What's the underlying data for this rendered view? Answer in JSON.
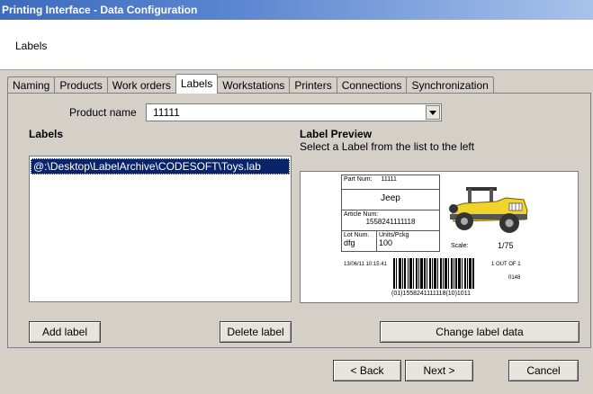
{
  "window": {
    "title": "Printing Interface - Data Configuration"
  },
  "header": {
    "step_title": "Labels"
  },
  "tabs": [
    {
      "label": "Naming",
      "active": false
    },
    {
      "label": "Products",
      "active": false
    },
    {
      "label": "Work orders",
      "active": false
    },
    {
      "label": "Labels",
      "active": true
    },
    {
      "label": "Workstations",
      "active": false
    },
    {
      "label": "Printers",
      "active": false
    },
    {
      "label": "Connections",
      "active": false
    },
    {
      "label": "Synchronization",
      "active": false
    }
  ],
  "product": {
    "label": "Product name",
    "value": "11111"
  },
  "labels_panel": {
    "heading": "Labels",
    "items": [
      "@:\\Desktop\\LabelArchive\\CODESOFT\\Toys.lab"
    ],
    "selected_index": 0
  },
  "preview": {
    "heading": "Label Preview",
    "hint": "Select a Label from the list to the left",
    "label": {
      "part_num_label": "Part Num:",
      "part_num_value": "11111",
      "name": "Jeep",
      "article_label": "Article Num:",
      "article_value": "1558241111118",
      "lot_label": "Lot Num.",
      "lot_value": "dfg",
      "units_label": "Units/Pckg",
      "units_value": "100",
      "scale_label": "Scale:",
      "scale_value": "1/75",
      "timestamp": "13/06/11 10:15:41",
      "count": "1 OUT OF 1",
      "code": "0148",
      "barcode_text": "(01)1558241111118(10)1011"
    }
  },
  "buttons": {
    "add_label": "Add label",
    "delete_label": "Delete label",
    "change_label_data": "Change label data",
    "back": "< Back",
    "next": "Next >",
    "cancel": "Cancel"
  },
  "colors": {
    "title_gradient_start": "#3d6bbd",
    "selection": "#0a246a",
    "jeep_body": "#f2d32a"
  }
}
